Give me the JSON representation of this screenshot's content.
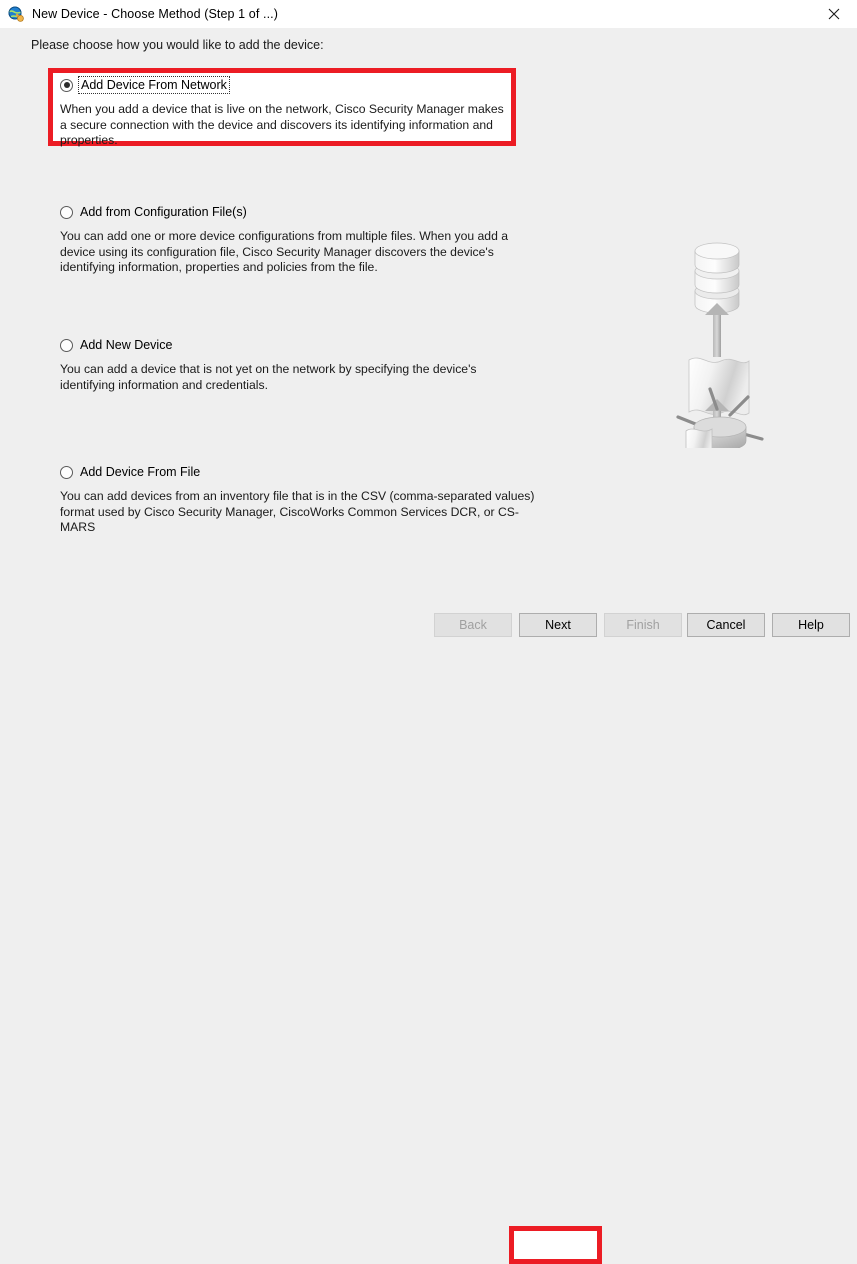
{
  "window": {
    "title": "New Device - Choose Method (Step 1 of ...)",
    "icon": "globe-device-icon",
    "close_label": "✕",
    "background_color": "#efefef",
    "titlebar_color": "#ffffff"
  },
  "main": {
    "instruction": "Please choose how you would like to add the device:",
    "highlight_color": "#ec1c24",
    "options": [
      {
        "id": "network",
        "label": "Add Device From Network",
        "description": "When you add a device that is live on the network, Cisco Security Manager makes a secure connection with the device and discovers its identifying information and properties.",
        "selected": true,
        "focused": true,
        "highlighted": true
      },
      {
        "id": "config",
        "label": "Add from Configuration File(s)",
        "description": "You can add one or more device configurations from multiple files. When you add a device using its configuration file, Cisco Security Manager discovers the device's identifying information, properties and policies from the file.",
        "selected": false,
        "focused": false,
        "highlighted": false
      },
      {
        "id": "new",
        "label": "Add New Device",
        "description": "You can add a device that is not yet on the network by specifying the device's identifying information and credentials.",
        "selected": false,
        "focused": false,
        "highlighted": false
      },
      {
        "id": "file",
        "label": "Add Device From File",
        "description": "You can add devices from an inventory file that is in the CSV (comma-separated values) format used by Cisco Security Manager, CiscoWorks Common Services DCR, or CS-MARS",
        "selected": false,
        "focused": false,
        "highlighted": false
      }
    ],
    "illustration": {
      "name": "database-document-router-flow-illustration",
      "parts": [
        "database-stack-icon",
        "down-arrow-icon",
        "document-scroll-icon",
        "down-arrow-icon",
        "network-router-icon"
      ]
    }
  },
  "buttons": {
    "back": {
      "label": "Back",
      "disabled": true,
      "highlighted": false
    },
    "next": {
      "label": "Next",
      "disabled": false,
      "highlighted": true
    },
    "finish": {
      "label": "Finish",
      "disabled": true,
      "highlighted": false
    },
    "cancel": {
      "label": "Cancel",
      "disabled": false,
      "highlighted": false
    },
    "help": {
      "label": "Help",
      "disabled": false,
      "highlighted": false
    }
  }
}
